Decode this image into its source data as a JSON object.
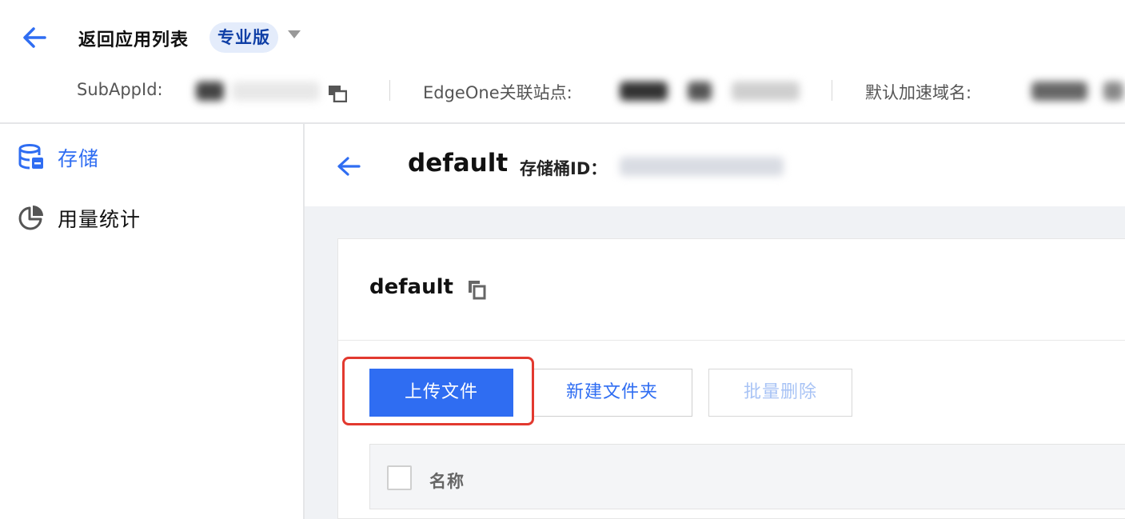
{
  "header": {
    "back_label": "返回应用列表",
    "edition": "专业版",
    "meta": {
      "subappid_label": "SubAppId:",
      "edgeone_label": "EdgeOne关联站点:",
      "domain_label": "默认加速域名:"
    }
  },
  "sidebar": {
    "items": [
      {
        "label": "存储",
        "icon": "database-icon",
        "active": true
      },
      {
        "label": "用量统计",
        "icon": "pie-chart-icon",
        "active": false
      }
    ]
  },
  "bucket": {
    "name": "default",
    "id_label": "存储桶ID："
  },
  "card": {
    "title": "default",
    "buttons": {
      "upload": "上传文件",
      "new_folder": "新建文件夹",
      "batch_delete": "批量删除"
    },
    "table": {
      "columns": [
        "名称"
      ]
    }
  },
  "colors": {
    "primary": "#2f6df2",
    "highlight": "#e2392f",
    "badge_bg": "#e4ecfb",
    "badge_text": "#0f3fa6"
  }
}
